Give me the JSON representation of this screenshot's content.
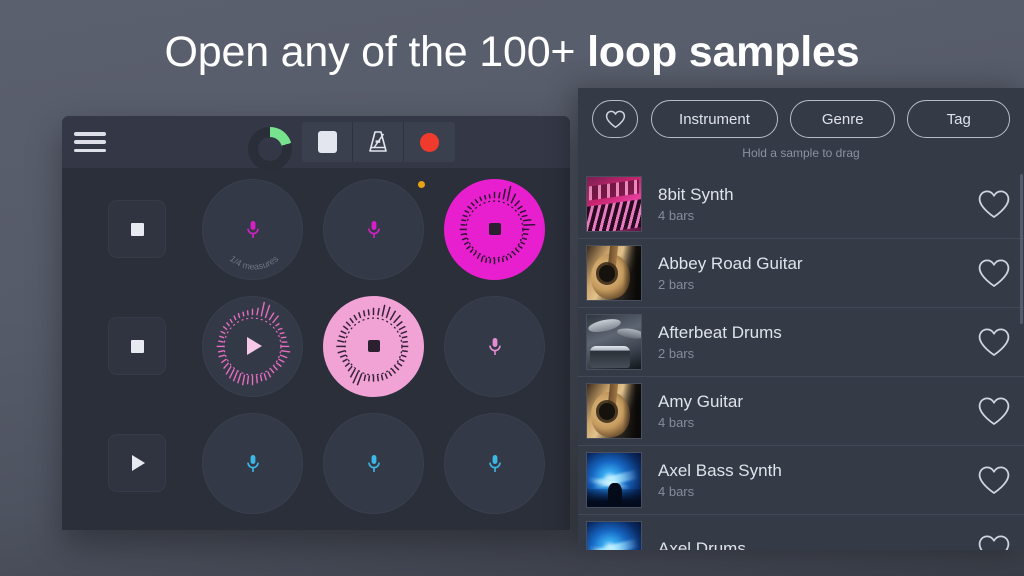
{
  "headline": {
    "light_part": "Open any of the 100+ ",
    "bold_part": "loop samples"
  },
  "app": {
    "toolbar": {
      "menu_icon": "hamburger-menu-icon",
      "loop_progress_icon": "loop-progress-dial",
      "loop_progress_percent": 20,
      "stop_label": "stop-icon",
      "metronome_label": "metronome-icon",
      "record_label": "record-icon"
    },
    "pads": {
      "measure_label": "1/4 measures",
      "rows": [
        {
          "left_button": "stop",
          "cells": [
            {
              "state": "empty",
              "mic_color": "#d61fc8",
              "label": "1/4 measures",
              "badge": false
            },
            {
              "state": "empty",
              "mic_color": "#d61fc8",
              "label": "",
              "badge": true
            },
            {
              "state": "recording",
              "fill": "#e81fcf",
              "center": "stop",
              "label": "",
              "badge": false
            }
          ]
        },
        {
          "left_button": "stop",
          "cells": [
            {
              "state": "loaded",
              "fill": "none",
              "center": "play",
              "label": "",
              "badge": false
            },
            {
              "state": "playing",
              "fill": "#f2a3d5",
              "center": "stop",
              "label": "",
              "badge": false
            },
            {
              "state": "empty",
              "mic_color": "#e48cd0",
              "label": "",
              "badge": false
            }
          ]
        },
        {
          "left_button": "play",
          "cells": [
            {
              "state": "empty",
              "mic_color": "#3bb8e8",
              "label": "",
              "badge": false
            },
            {
              "state": "empty",
              "mic_color": "#3bb8e8",
              "label": "",
              "badge": false
            },
            {
              "state": "empty",
              "mic_color": "#3bb8e8",
              "label": "",
              "badge": false
            }
          ]
        }
      ]
    }
  },
  "browser": {
    "filters": [
      {
        "id": "favorites",
        "label": "",
        "icon": "heart-icon"
      },
      {
        "id": "instrument",
        "label": "Instrument",
        "icon": ""
      },
      {
        "id": "genre",
        "label": "Genre",
        "icon": ""
      },
      {
        "id": "tag",
        "label": "Tag",
        "icon": ""
      }
    ],
    "hint": "Hold a sample to drag",
    "samples": [
      {
        "name": "8bit Synth",
        "bars": "4 bars",
        "art": "synth"
      },
      {
        "name": "Abbey Road Guitar",
        "bars": "2 bars",
        "art": "guitar"
      },
      {
        "name": "Afterbeat Drums",
        "bars": "2 bars",
        "art": "drums"
      },
      {
        "name": "Amy Guitar",
        "bars": "4 bars",
        "art": "guitar"
      },
      {
        "name": "Axel Bass Synth",
        "bars": "4 bars",
        "art": "stage"
      },
      {
        "name": "Axel Drums",
        "bars": "",
        "art": "stage"
      }
    ]
  },
  "colors": {
    "accent_bright": "#e81fcf",
    "accent_light": "#f2a3d5",
    "mic_blue": "#3bb8e8",
    "record_red": "#f03a2e",
    "progress_green": "#77e38f",
    "badge_amber": "#e8a317",
    "panel_bg": "#353a47",
    "app_bg": "#2b2f3a"
  }
}
